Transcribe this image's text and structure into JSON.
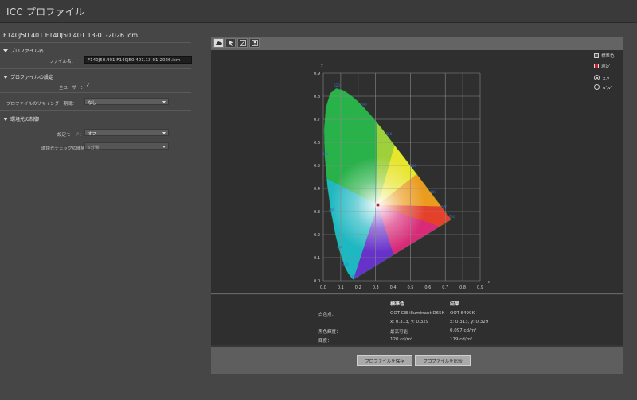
{
  "window": {
    "title": "ICC プロファイル"
  },
  "file": {
    "name": "F140J50.401  F140J50.401.13-01-2026.icm"
  },
  "sections": {
    "profile_name": {
      "heading": "プロファイル名",
      "file_name_label": "ファイル名：",
      "file_name_value": "F140J50.401  F140J50.401.13-01-2026.icm"
    },
    "profile_settings": {
      "heading": "プロファイルの設定",
      "all_users_label": "全ユーザー：",
      "all_users_checked": true,
      "reminder_label": "プロファイルのリマインダー期間：",
      "reminder_value": "なし"
    },
    "ambient": {
      "heading": "環境光の制御",
      "mode_label": "設定モード：",
      "mode_value": "オフ",
      "check_label": "環境光チェックの間隔：",
      "check_value": "5分後"
    }
  },
  "toolbar": {
    "tools": [
      {
        "name": "gamut-view-icon",
        "active": true
      },
      {
        "name": "pointer-icon",
        "active": false
      },
      {
        "name": "curve-icon",
        "active": false
      },
      {
        "name": "image-icon",
        "active": false
      }
    ]
  },
  "legend": {
    "standard_label": "標準色",
    "measured_label": "測定",
    "xy_option": "x,y",
    "uv_option": "u',v'",
    "selected": "x,y"
  },
  "chart_data": {
    "type": "scatter",
    "title": "",
    "xlabel": "x",
    "ylabel": "y",
    "xlim": [
      0,
      0.9
    ],
    "ylim": [
      0,
      0.9
    ],
    "x_ticks": [
      "0.0",
      "0.1",
      "0.2",
      "0.3",
      "0.4",
      "0.5",
      "0.6",
      "0.7",
      "0.8",
      "0.9"
    ],
    "y_ticks": [
      "0.0",
      "0.1",
      "0.2",
      "0.3",
      "0.4",
      "0.5",
      "0.6",
      "0.7",
      "0.8",
      "0.9"
    ],
    "grid": true,
    "series": [
      {
        "name": "標準色",
        "x": [
          0.313
        ],
        "y": [
          0.329
        ]
      },
      {
        "name": "測定",
        "x": [
          0.313
        ],
        "y": [
          0.329
        ]
      }
    ],
    "locus_labels": [
      {
        "text": "520",
        "x": 0.074,
        "y": 0.834
      },
      {
        "text": "540",
        "x": 0.23,
        "y": 0.754
      },
      {
        "text": "560",
        "x": 0.373,
        "y": 0.624
      },
      {
        "text": "580",
        "x": 0.512,
        "y": 0.487
      },
      {
        "text": "600",
        "x": 0.627,
        "y": 0.373
      },
      {
        "text": "620",
        "x": 0.691,
        "y": 0.308
      },
      {
        "text": "700",
        "x": 0.735,
        "y": 0.265
      },
      {
        "text": "500",
        "x": 0.008,
        "y": 0.538
      },
      {
        "text": "490",
        "x": 0.045,
        "y": 0.295
      },
      {
        "text": "480",
        "x": 0.091,
        "y": 0.133
      },
      {
        "text": "470",
        "x": 0.124,
        "y": 0.058
      },
      {
        "text": "380",
        "x": 0.174,
        "y": 0.005
      }
    ]
  },
  "info": {
    "col_standard": "標準色",
    "col_measured": "結果",
    "rows": [
      {
        "label": "白色点：",
        "standard": "OOT-CIE illuminant D65K",
        "measured": "OOT-6499K"
      },
      {
        "label": "",
        "standard": "x: 0.313, y: 0.329",
        "measured": "x: 0.313, y: 0.329"
      },
      {
        "label": "黒色輝度：",
        "standard": "最高可能",
        "measured": "0.097 cd/m²"
      },
      {
        "label": "輝度：",
        "standard": "120 cd/m²",
        "measured": "119 cd/m²"
      }
    ]
  },
  "buttons": {
    "save": "プロファイルを保存",
    "compare": "プロファイルを比較"
  }
}
